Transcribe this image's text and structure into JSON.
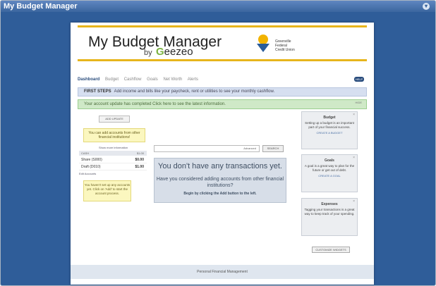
{
  "window": {
    "title": "My Budget Manager"
  },
  "header": {
    "app_name": "My Budget Manager",
    "by": "by",
    "brand": "Geezeo",
    "cu_name_lines": [
      "Greenville",
      "Federal",
      "Credit Union"
    ]
  },
  "nav": {
    "items": [
      "Dashboard",
      "Budget",
      "Cashflow",
      "Goals",
      "Net Worth",
      "Alerts"
    ],
    "help": "HELP"
  },
  "first_steps": {
    "label": "FIRST STEPS",
    "text": "Add income and bills like your paycheck, rent or utilities to see your monthly cashflow."
  },
  "update_banner": {
    "text": "Your account update has completed Click here to see the latest information.",
    "hide": "HIDE"
  },
  "left": {
    "buttons": "ADD   UPDATE",
    "tip": "You can add accounts from other financial institutions!",
    "show_more": "Show more information",
    "cash_header": "CASH",
    "cash_total": "$1.00",
    "accounts": [
      {
        "name": "Share (S000)",
        "amount": "$0.00"
      },
      {
        "name": "Draft (D010)",
        "amount": "$1.00"
      }
    ],
    "edit_accounts": "Edit Accounts",
    "notice": "You haven't set up any accounts yet. Click on 'Add' to start the account process."
  },
  "center": {
    "search_advanced": "Advanced",
    "search_button": "SEARCH",
    "empty_title": "You don't have any transactions yet.",
    "empty_question": "Have you considered adding accounts from other financial institutions?",
    "empty_hint": "Begin by clicking the Add button to the left."
  },
  "widgets": [
    {
      "title": "Budget",
      "desc": "Setting up a budget is an important part of your financial success.",
      "link": "CREATE A BUDGET"
    },
    {
      "title": "Goals",
      "desc": "A goal is a great way to plan for the future or get out of debt.",
      "link": "CREATE A GOAL"
    },
    {
      "title": "Expenses",
      "desc": "Tagging your transactions is a great way to keep track of your spending.",
      "link": ""
    }
  ],
  "customize": "CUSTOMIZE WIDGETS",
  "footer": "Personal Financial Management",
  "colors": {
    "accent": "#e7b51c",
    "frame": "#2f5d99",
    "nav_active": "#2a4d7d"
  }
}
